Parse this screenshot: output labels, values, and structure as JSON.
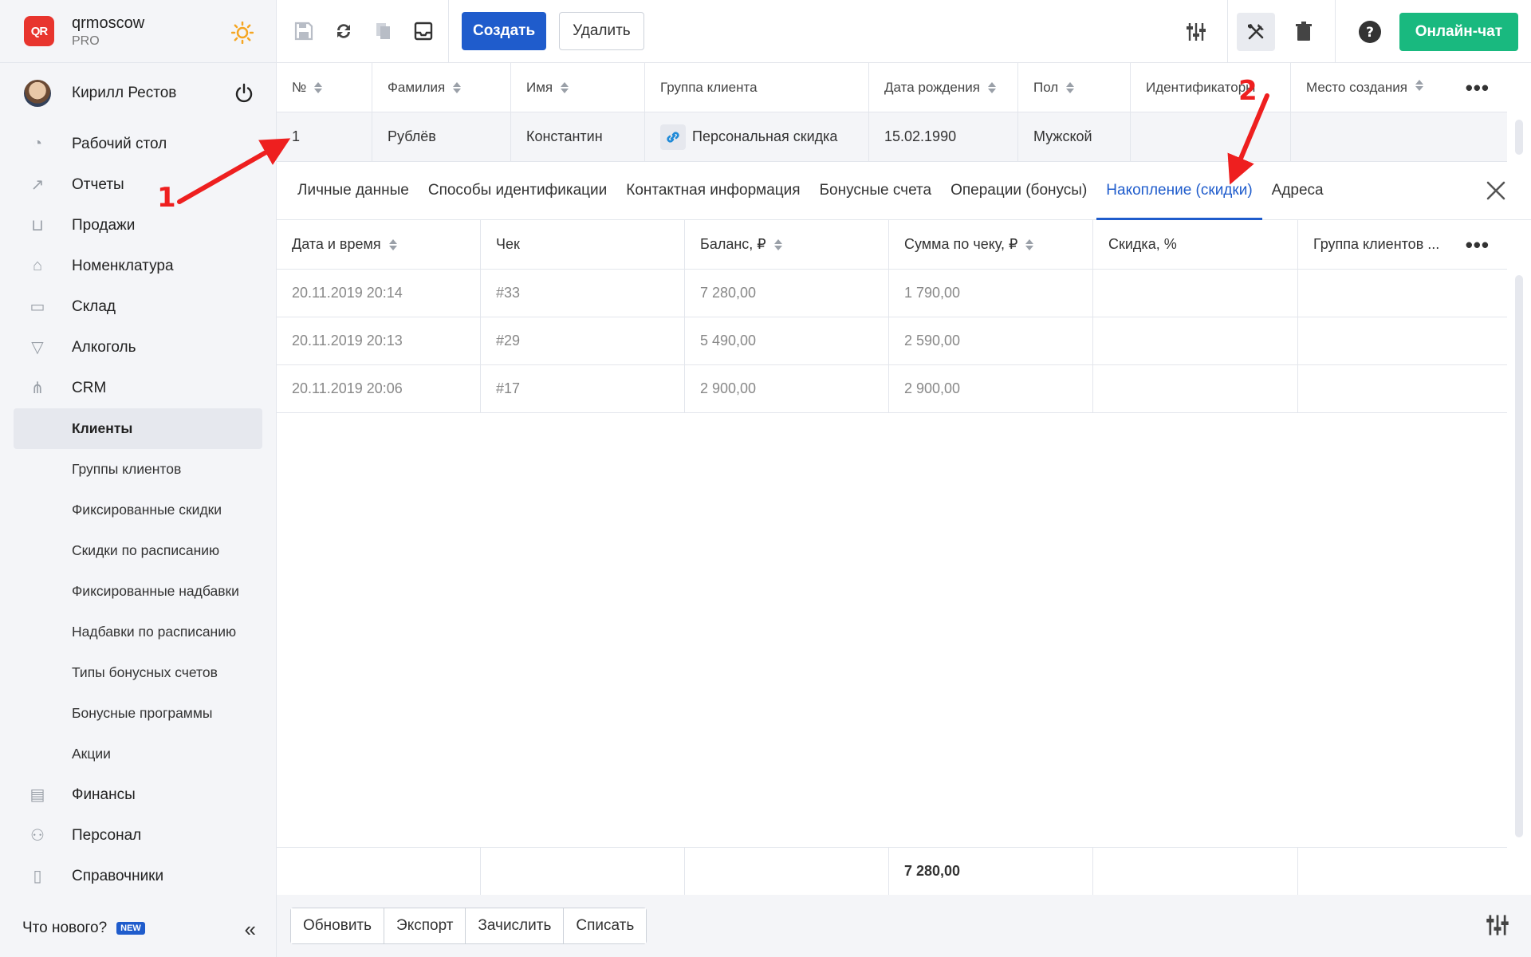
{
  "brand": {
    "logo_text": "QR",
    "name": "qrmoscow",
    "plan": "PRO"
  },
  "user": {
    "name": "Кирилл Рестов"
  },
  "nav": [
    {
      "label": "Рабочий стол",
      "icon": "dashboard-gauge-icon"
    },
    {
      "label": "Отчеты",
      "icon": "chart-trend-icon"
    },
    {
      "label": "Продажи",
      "icon": "basket-icon"
    },
    {
      "label": "Номенклатура",
      "icon": "tag-icon"
    },
    {
      "label": "Склад",
      "icon": "archive-box-icon"
    },
    {
      "label": "Алкоголь",
      "icon": "cocktail-glass-icon"
    },
    {
      "label": "CRM",
      "icon": "org-tree-icon"
    }
  ],
  "crm_sub": [
    {
      "label": "Клиенты",
      "active": true
    },
    {
      "label": "Группы клиентов"
    },
    {
      "label": "Фиксированные скидки"
    },
    {
      "label": "Скидки по расписанию"
    },
    {
      "label": "Фиксированные надбавки"
    },
    {
      "label": "Надбавки по расписанию"
    },
    {
      "label": "Типы бонусных счетов"
    },
    {
      "label": "Бонусные программы"
    },
    {
      "label": "Акции"
    }
  ],
  "nav_bottom": [
    {
      "label": "Финансы",
      "icon": "wallet-icon"
    },
    {
      "label": "Персонал",
      "icon": "people-icon"
    },
    {
      "label": "Справочники",
      "icon": "book-icon"
    }
  ],
  "whats_new": {
    "label": "Что нового?",
    "badge": "NEW"
  },
  "toolbar": {
    "create_label": "Создать",
    "delete_label": "Удалить",
    "chat_label": "Онлайн-чат"
  },
  "clients_table": {
    "headers": [
      "№",
      "Фамилия",
      "Имя",
      "Группа клиента",
      "Дата рождения",
      "Пол",
      "Идентификаторы",
      "Место создания"
    ],
    "row": [
      "1",
      "Рублёв",
      "Константин",
      "Персональная скидка",
      "15.02.1990",
      "Мужской",
      "",
      ""
    ]
  },
  "tabs": [
    "Личные данные",
    "Способы идентификации",
    "Контактная информация",
    "Бонусные счета",
    "Операции (бонусы)",
    "Накопление (скидки)",
    "Адреса"
  ],
  "active_tab_index": 5,
  "accum_table": {
    "headers": [
      "Дата и время",
      "Чек",
      "Баланс, ₽",
      "Сумма по чеку, ₽",
      "Скидка, %",
      "Группа клиентов ..."
    ],
    "rows": [
      [
        "20.11.2019 20:14",
        "#33",
        "7 280,00",
        "1 790,00",
        "",
        ""
      ],
      [
        "20.11.2019 20:13",
        "#29",
        "5 490,00",
        "2 590,00",
        "",
        ""
      ],
      [
        "20.11.2019 20:06",
        "#17",
        "2 900,00",
        "2 900,00",
        "",
        ""
      ]
    ],
    "footer_total": "7 280,00"
  },
  "bottom_actions": [
    "Обновить",
    "Экспорт",
    "Зачислить",
    "Списать"
  ],
  "annotations": {
    "marker_1": "1",
    "marker_2": "2"
  },
  "colors": {
    "primary": "#1f5ccc",
    "chat": "#19b97f",
    "annotation": "#ee1f1f",
    "logo": "#e8352e"
  }
}
